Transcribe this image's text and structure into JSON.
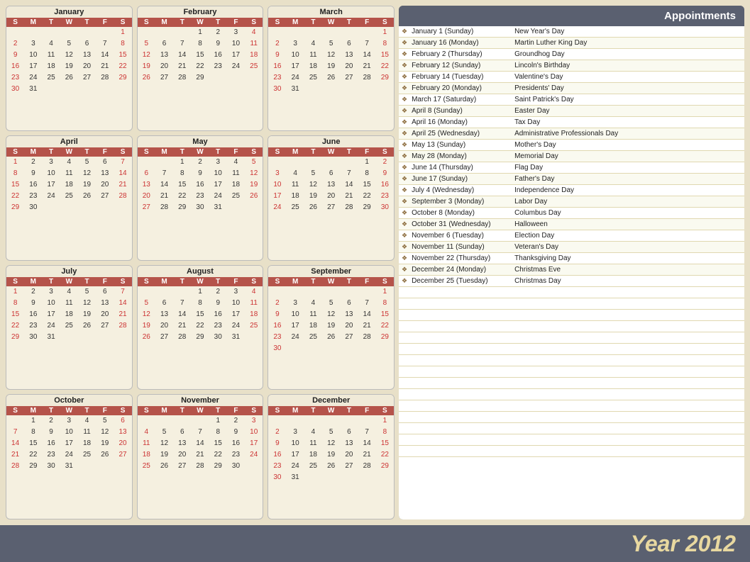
{
  "year": "Year 2012",
  "appointments_title": "Appointments",
  "appointments": [
    {
      "date": "January 1 (Sunday)",
      "name": "New Year's Day"
    },
    {
      "date": "January 16 (Monday)",
      "name": "Martin Luther King Day"
    },
    {
      "date": "February 2 (Thursday)",
      "name": "Groundhog Day"
    },
    {
      "date": "February 12 (Sunday)",
      "name": "Lincoln's Birthday"
    },
    {
      "date": "February 14 (Tuesday)",
      "name": "Valentine's Day"
    },
    {
      "date": "February 20 (Monday)",
      "name": "Presidents' Day"
    },
    {
      "date": "March 17 (Saturday)",
      "name": "Saint Patrick's Day"
    },
    {
      "date": "April 8 (Sunday)",
      "name": "Easter Day"
    },
    {
      "date": "April 16 (Monday)",
      "name": "Tax Day"
    },
    {
      "date": "April 25 (Wednesday)",
      "name": "Administrative Professionals Day"
    },
    {
      "date": "May 13 (Sunday)",
      "name": "Mother's Day"
    },
    {
      "date": "May 28 (Monday)",
      "name": "Memorial Day"
    },
    {
      "date": "June 14 (Thursday)",
      "name": "Flag Day"
    },
    {
      "date": "June 17 (Sunday)",
      "name": "Father's Day"
    },
    {
      "date": "July 4 (Wednesday)",
      "name": "Independence Day"
    },
    {
      "date": "September 3 (Monday)",
      "name": "Labor Day"
    },
    {
      "date": "October 8 (Monday)",
      "name": "Columbus Day"
    },
    {
      "date": "October 31 (Wednesday)",
      "name": "Halloween"
    },
    {
      "date": "November 6 (Tuesday)",
      "name": "Election Day"
    },
    {
      "date": "November 11 (Sunday)",
      "name": "Veteran's Day"
    },
    {
      "date": "November 22 (Thursday)",
      "name": "Thanksgiving Day"
    },
    {
      "date": "December 24 (Monday)",
      "name": "Christmas Eve"
    },
    {
      "date": "December 25 (Tuesday)",
      "name": "Christmas Day"
    }
  ],
  "months": [
    {
      "name": "January",
      "days_header": [
        "S",
        "M",
        "T",
        "W",
        "T",
        "F",
        "S"
      ],
      "weeks": [
        [
          " ",
          " ",
          " ",
          " ",
          " ",
          " ",
          "1"
        ],
        [
          "2",
          "3",
          "4",
          "5",
          "6",
          "7",
          "8"
        ],
        [
          "9",
          "10",
          "11",
          "12",
          "13",
          "14",
          "15"
        ],
        [
          "16",
          "17",
          "18",
          "19",
          "20",
          "21",
          "22"
        ],
        [
          "23",
          "24",
          "25",
          "26",
          "27",
          "28",
          "29"
        ],
        [
          "30",
          "31",
          " ",
          " ",
          " ",
          " ",
          " "
        ]
      ]
    },
    {
      "name": "February",
      "weeks": [
        [
          " ",
          " ",
          " ",
          "1",
          "2",
          "3",
          "4"
        ],
        [
          "5",
          "6",
          "7",
          "8",
          "9",
          "10",
          "11"
        ],
        [
          "12",
          "13",
          "14",
          "15",
          "16",
          "17",
          "18"
        ],
        [
          "19",
          "20",
          "21",
          "22",
          "23",
          "24",
          "25"
        ],
        [
          "26",
          "27",
          "28",
          "29",
          " ",
          " ",
          " "
        ]
      ]
    },
    {
      "name": "March",
      "weeks": [
        [
          " ",
          " ",
          " ",
          " ",
          " ",
          " ",
          "1"
        ],
        [
          "2",
          "3",
          "4",
          "5",
          "6",
          "7",
          "8"
        ],
        [
          "9",
          "10",
          "11",
          "12",
          "13",
          "14",
          "15"
        ],
        [
          "16",
          "17",
          "18",
          "19",
          "20",
          "21",
          "22"
        ],
        [
          "23",
          "24",
          "25",
          "26",
          "27",
          "28",
          "29"
        ],
        [
          "30",
          "31",
          " ",
          " ",
          " ",
          " ",
          " "
        ]
      ]
    },
    {
      "name": "April",
      "weeks": [
        [
          "1",
          "2",
          "3",
          "4",
          "5",
          "6",
          "7"
        ],
        [
          "8",
          "9",
          "10",
          "11",
          "12",
          "13",
          "14"
        ],
        [
          "15",
          "16",
          "17",
          "18",
          "19",
          "20",
          "21"
        ],
        [
          "22",
          "23",
          "24",
          "25",
          "26",
          "27",
          "28"
        ],
        [
          "29",
          "30",
          " ",
          " ",
          " ",
          " ",
          " "
        ]
      ]
    },
    {
      "name": "May",
      "weeks": [
        [
          " ",
          " ",
          "1",
          "2",
          "3",
          "4",
          "5"
        ],
        [
          "6",
          "7",
          "8",
          "9",
          "10",
          "11",
          "12"
        ],
        [
          "13",
          "14",
          "15",
          "16",
          "17",
          "18",
          "19"
        ],
        [
          "20",
          "21",
          "22",
          "23",
          "24",
          "25",
          "26"
        ],
        [
          "27",
          "28",
          "29",
          "30",
          "31",
          " ",
          " "
        ]
      ]
    },
    {
      "name": "June",
      "weeks": [
        [
          " ",
          " ",
          " ",
          " ",
          " ",
          "1",
          "2"
        ],
        [
          "3",
          "4",
          "5",
          "6",
          "7",
          "8",
          "9"
        ],
        [
          "10",
          "11",
          "12",
          "13",
          "14",
          "15",
          "16"
        ],
        [
          "17",
          "18",
          "19",
          "20",
          "21",
          "22",
          "23"
        ],
        [
          "24",
          "25",
          "26",
          "27",
          "28",
          "29",
          "30"
        ]
      ]
    },
    {
      "name": "July",
      "weeks": [
        [
          "1",
          "2",
          "3",
          "4",
          "5",
          "6",
          "7"
        ],
        [
          "8",
          "9",
          "10",
          "11",
          "12",
          "13",
          "14"
        ],
        [
          "15",
          "16",
          "17",
          "18",
          "19",
          "20",
          "21"
        ],
        [
          "22",
          "23",
          "24",
          "25",
          "26",
          "27",
          "28"
        ],
        [
          "29",
          "30",
          "31",
          " ",
          " ",
          " ",
          " "
        ]
      ]
    },
    {
      "name": "August",
      "weeks": [
        [
          " ",
          " ",
          " ",
          "1",
          "2",
          "3",
          "4"
        ],
        [
          "5",
          "6",
          "7",
          "8",
          "9",
          "10",
          "11"
        ],
        [
          "12",
          "13",
          "14",
          "15",
          "16",
          "17",
          "18"
        ],
        [
          "19",
          "20",
          "21",
          "22",
          "23",
          "24",
          "25"
        ],
        [
          "26",
          "27",
          "28",
          "29",
          "30",
          "31",
          " "
        ]
      ]
    },
    {
      "name": "September",
      "weeks": [
        [
          " ",
          " ",
          " ",
          " ",
          " ",
          " ",
          "1"
        ],
        [
          "2",
          "3",
          "4",
          "5",
          "6",
          "7",
          "8"
        ],
        [
          "9",
          "10",
          "11",
          "12",
          "13",
          "14",
          "15"
        ],
        [
          "16",
          "17",
          "18",
          "19",
          "20",
          "21",
          "22"
        ],
        [
          "23",
          "24",
          "25",
          "26",
          "27",
          "28",
          "29"
        ],
        [
          "30",
          " ",
          " ",
          " ",
          " ",
          " ",
          " "
        ]
      ]
    },
    {
      "name": "October",
      "weeks": [
        [
          " ",
          "1",
          "2",
          "3",
          "4",
          "5",
          "6"
        ],
        [
          "7",
          "8",
          "9",
          "10",
          "11",
          "12",
          "13"
        ],
        [
          "14",
          "15",
          "16",
          "17",
          "18",
          "19",
          "20"
        ],
        [
          "21",
          "22",
          "23",
          "24",
          "25",
          "26",
          "27"
        ],
        [
          "28",
          "29",
          "30",
          "31",
          " ",
          " ",
          " "
        ]
      ]
    },
    {
      "name": "November",
      "weeks": [
        [
          " ",
          " ",
          " ",
          " ",
          "1",
          "2",
          "3"
        ],
        [
          "4",
          "5",
          "6",
          "7",
          "8",
          "9",
          "10"
        ],
        [
          "11",
          "12",
          "13",
          "14",
          "15",
          "16",
          "17"
        ],
        [
          "18",
          "19",
          "20",
          "21",
          "22",
          "23",
          "24"
        ],
        [
          "25",
          "26",
          "27",
          "28",
          "29",
          "30",
          " "
        ]
      ]
    },
    {
      "name": "December",
      "weeks": [
        [
          " ",
          " ",
          " ",
          " ",
          " ",
          " ",
          "1"
        ],
        [
          "2",
          "3",
          "4",
          "5",
          "6",
          "7",
          "8"
        ],
        [
          "9",
          "10",
          "11",
          "12",
          "13",
          "14",
          "15"
        ],
        [
          "16",
          "17",
          "18",
          "19",
          "20",
          "21",
          "22"
        ],
        [
          "23",
          "24",
          "25",
          "26",
          "27",
          "28",
          "29"
        ],
        [
          "30",
          "31",
          " ",
          " ",
          " ",
          " ",
          " "
        ]
      ]
    }
  ]
}
